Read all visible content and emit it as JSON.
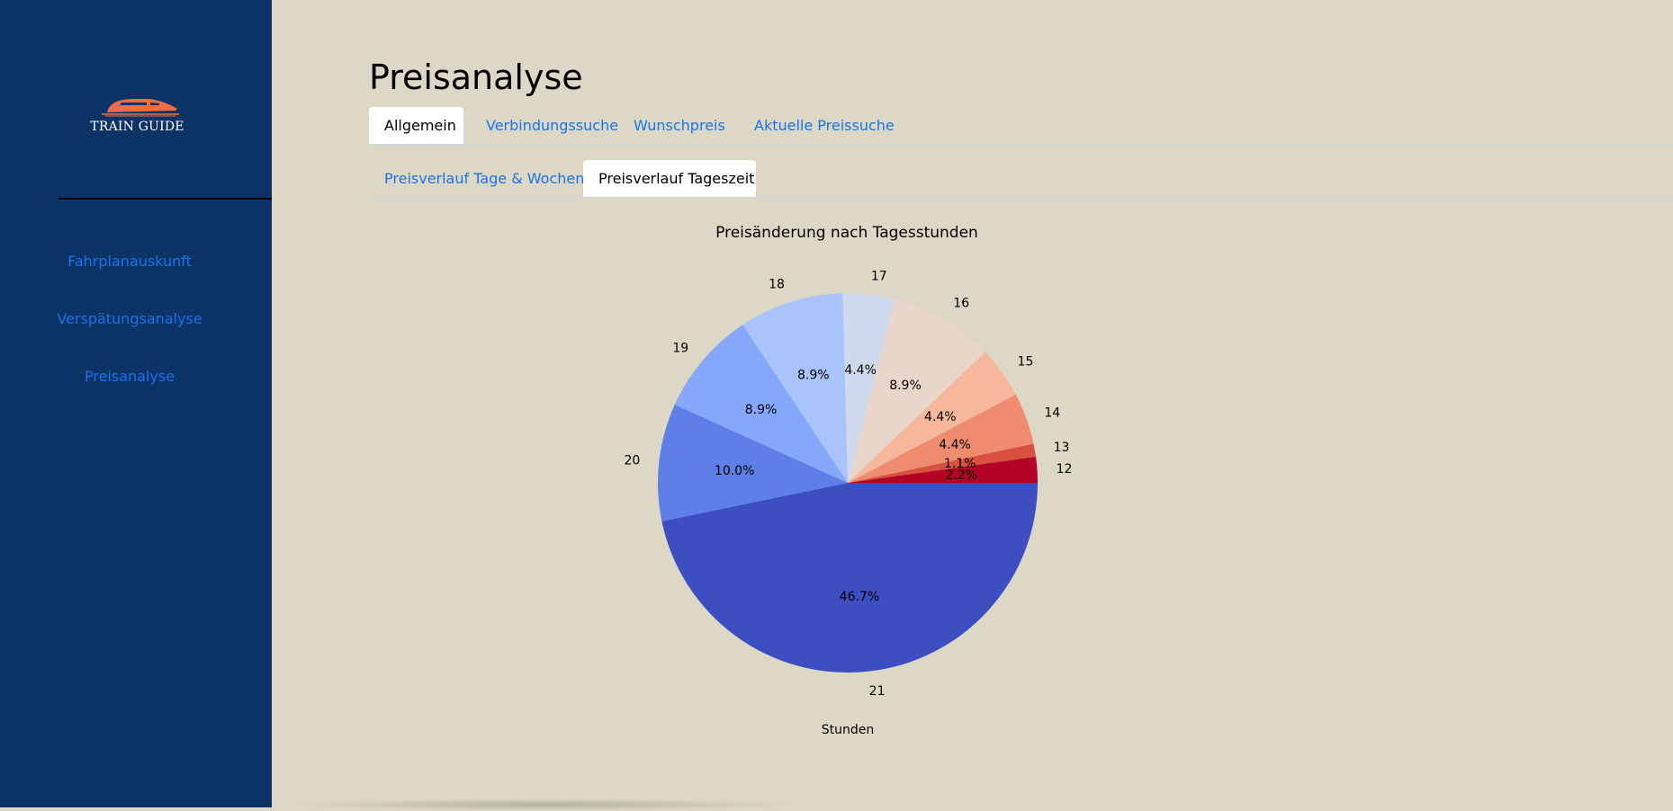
{
  "sidebar": {
    "logo_text": "TRAIN GUIDE",
    "items": [
      {
        "label": "Fahrplanauskunft"
      },
      {
        "label": "Verspätungsanalyse"
      },
      {
        "label": "Preisanalyse"
      }
    ]
  },
  "page": {
    "title": "Preisanalyse"
  },
  "tabs": [
    {
      "label": "Allgemein",
      "active": true
    },
    {
      "label": "Verbindungssuche",
      "active": false
    },
    {
      "label": "Wunschpreis",
      "active": false
    },
    {
      "label": "Aktuelle Preissuche",
      "active": false
    }
  ],
  "subtabs": [
    {
      "label": "Preisverlauf Tage & Wochen",
      "active": false
    },
    {
      "label": "Preisverlauf Tageszeit",
      "active": true
    }
  ],
  "colors": {
    "sidebar_bg": "#0b3366",
    "page_bg": "#ddd8c6",
    "link": "#1a73e8",
    "logo_accent": "#f26b43"
  },
  "chart_data": {
    "type": "pie",
    "title": "Preisänderung nach Tagesstunden",
    "xlabel": "Stunden",
    "slices": [
      {
        "label": "12",
        "value": 2.2,
        "pct_label": "2.2%",
        "color": "#b40426"
      },
      {
        "label": "13",
        "value": 1.1,
        "pct_label": "1.1%",
        "color": "#d8503f"
      },
      {
        "label": "14",
        "value": 4.4,
        "pct_label": "4.4%",
        "color": "#ef8c70"
      },
      {
        "label": "15",
        "value": 4.4,
        "pct_label": "4.4%",
        "color": "#f7b79a"
      },
      {
        "label": "16",
        "value": 8.9,
        "pct_label": "8.9%",
        "color": "#e9d5ca"
      },
      {
        "label": "17",
        "value": 4.4,
        "pct_label": "4.4%",
        "color": "#cdd9ec"
      },
      {
        "label": "18",
        "value": 8.9,
        "pct_label": "8.9%",
        "color": "#a9c4fc"
      },
      {
        "label": "19",
        "value": 8.9,
        "pct_label": "8.9%",
        "color": "#85a8fc"
      },
      {
        "label": "20",
        "value": 10.0,
        "pct_label": "10.0%",
        "color": "#5f7fe8"
      },
      {
        "label": "21",
        "value": 46.7,
        "pct_label": "46.7%",
        "color": "#3c4ec2"
      }
    ],
    "start_angle_deg": 0,
    "direction": "counterclockwise"
  }
}
